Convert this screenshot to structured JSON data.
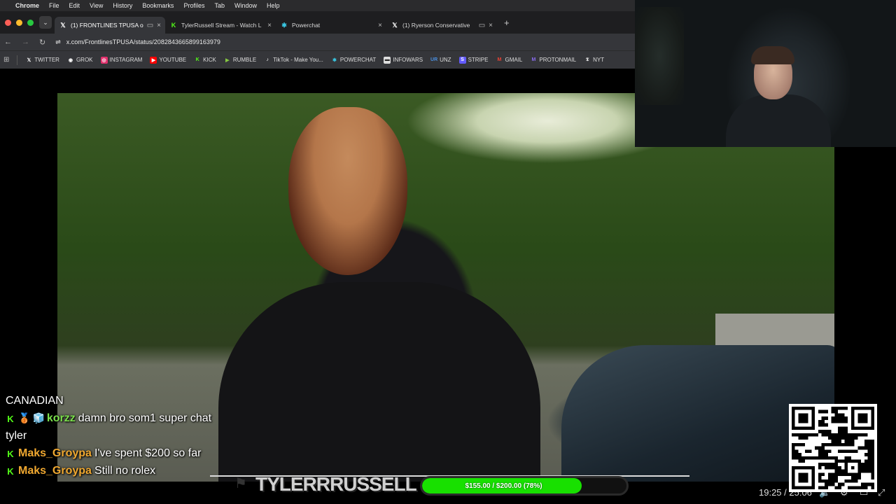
{
  "menubar": {
    "app": "Chrome",
    "items": [
      "File",
      "Edit",
      "View",
      "History",
      "Bookmarks",
      "Profiles",
      "Tab",
      "Window",
      "Help"
    ]
  },
  "tabs": [
    {
      "title": "(1) FRONTLINES TPUSA o",
      "icon": "x-icon",
      "active": true
    },
    {
      "title": "TylerRussell Stream - Watch L",
      "icon": "kick-icon",
      "active": false
    },
    {
      "title": "Powerchat",
      "icon": "powerchat-icon",
      "active": false
    },
    {
      "title": "(1) Ryerson Conservative",
      "icon": "x-icon",
      "active": false
    }
  ],
  "address": {
    "url": "x.com/FrontlinesTPUSA/status/2082843665899163979"
  },
  "bookmarks": [
    {
      "label": "TWITTER",
      "icon": "x-icon",
      "color": "#ffffff"
    },
    {
      "label": "GROK",
      "icon": "grok-icon",
      "color": "#ffffff"
    },
    {
      "label": "INSTAGRAM",
      "icon": "instagram-icon",
      "color": "#e1306c"
    },
    {
      "label": "YOUTUBE",
      "icon": "youtube-icon",
      "color": "#ff0000"
    },
    {
      "label": "KICK",
      "icon": "kick-icon",
      "color": "#53fc18"
    },
    {
      "label": "RUMBLE",
      "icon": "rumble-icon",
      "color": "#85c742"
    },
    {
      "label": "TikTok - Make You...",
      "icon": "tiktok-icon",
      "color": "#ffffff"
    },
    {
      "label": "POWERCHAT",
      "icon": "powerchat-icon",
      "color": "#39c5e0"
    },
    {
      "label": "INFOWARS",
      "icon": "infowars-icon",
      "color": "#dddddd"
    },
    {
      "label": "UNZ",
      "icon": "unz-icon",
      "color": "#4a8fe0"
    },
    {
      "label": "STRIPE",
      "icon": "stripe-icon",
      "color": "#635bff"
    },
    {
      "label": "GMAIL",
      "icon": "gmail-icon",
      "color": "#ea4335"
    },
    {
      "label": "PROTONMAIL",
      "icon": "protonmail-icon",
      "color": "#8b6cf0"
    },
    {
      "label": "NYT",
      "icon": "nyt-icon",
      "color": "#ffffff"
    }
  ],
  "chat": [
    {
      "text": "CANADIAN"
    },
    {
      "user": "korzz",
      "user_color": "#7be04c",
      "message": "damn bro som1 super chat tyler"
    },
    {
      "user": "Maks_Groypa",
      "user_color": "#f0a830",
      "message": "I've spent $200 so far"
    },
    {
      "user": "Maks_Groypa",
      "user_color": "#f0a830",
      "message": "Still no rolex"
    }
  ],
  "overlay": {
    "brand": "TYLERRRUSSELL",
    "goal_text": "$155.00 / $200.00 (78%)",
    "goal_fraction": 0.78
  },
  "player": {
    "time": "19:25 / 25:06"
  }
}
